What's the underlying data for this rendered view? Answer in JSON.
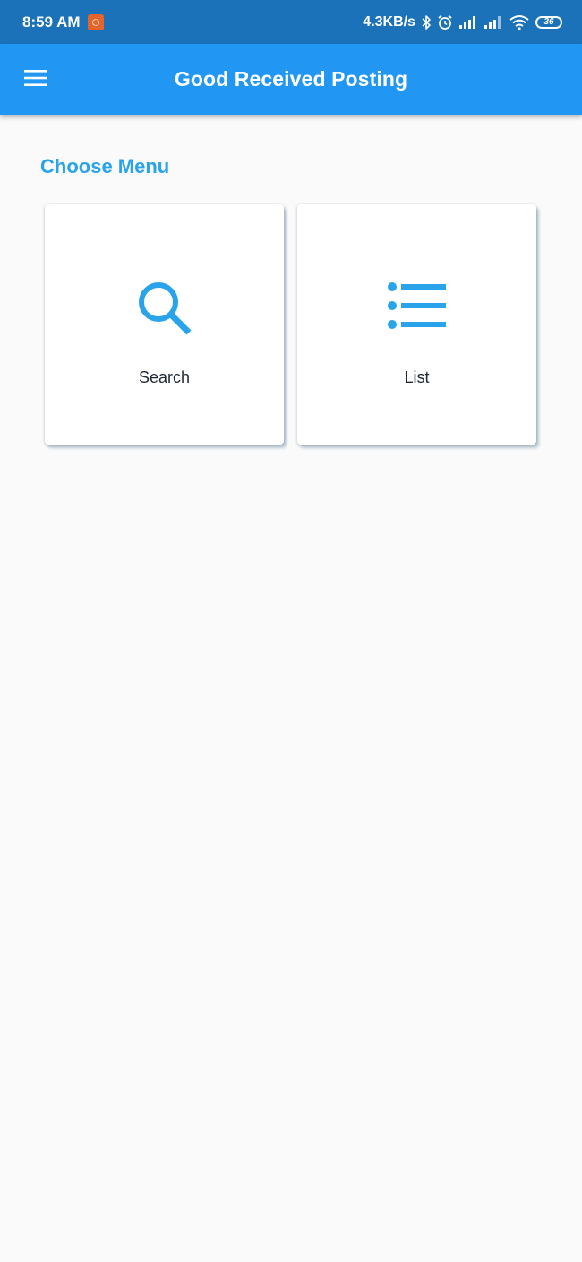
{
  "status_bar": {
    "time": "8:59 AM",
    "net_speed": "4.3KB/s",
    "battery": "36"
  },
  "app_bar": {
    "title": "Good Received Posting",
    "menu_icon": "menu-icon"
  },
  "content": {
    "section_title": "Choose Menu",
    "menu_items": [
      {
        "label": "Search",
        "icon": "search-icon"
      },
      {
        "label": "List",
        "icon": "list-icon"
      }
    ]
  },
  "colors": {
    "status_bar": "#1b72b9",
    "app_bar": "#2196f3",
    "accent": "#2aa3e8",
    "background": "#fafafa"
  }
}
